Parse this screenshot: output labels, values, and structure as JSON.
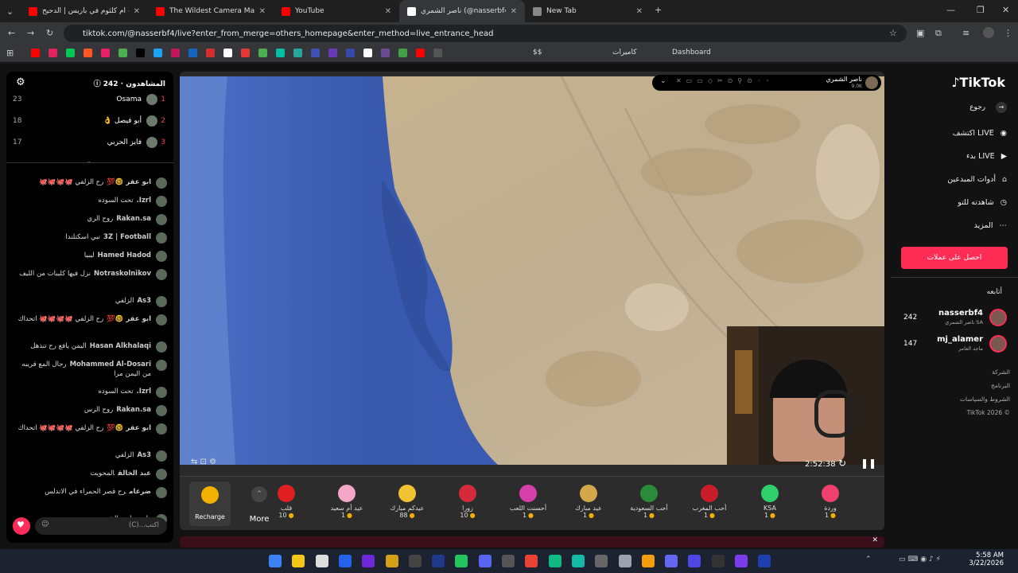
{
  "tabs": [
    {
      "label": "أم كلثوم في باريس | الدحيح - be",
      "color": "#ff0000"
    },
    {
      "label": "The Wildest Camera Market I've",
      "color": "#ff0000"
    },
    {
      "label": "YouTube",
      "color": "#ff0000"
    },
    {
      "label": "ناصر الشمري (@nasserbf4)",
      "color": "#ffffff"
    },
    {
      "label": "New Tab",
      "color": "#888888"
    }
  ],
  "address": {
    "url": "tiktok.com/@nasserbf4/live?enter_from_merge=others_homepage&enter_method=live_entrance_head"
  },
  "bookmarks": {
    "cameras_label": "كاميرات",
    "dashboard_label": "Dashboard",
    "dollars": "$$"
  },
  "chat": {
    "viewers_label": "المشاهدون",
    "viewers_count": "242",
    "top": [
      {
        "rank": "1",
        "name": "Osama",
        "score": "23",
        "rank_color": "#ff3b5c"
      },
      {
        "rank": "2",
        "name": "👌 أبو فيصل",
        "score": "18",
        "rank_color": "#ff3b5c"
      },
      {
        "rank": "3",
        "name": "فايز الحربي",
        "score": "17",
        "rank_color": "#ff3b5c"
      }
    ],
    "messages": [
      {
        "name": "ابو عقر 🤓💯",
        "text": "رح الزلفي 🐙🐙🐙🐙"
      },
      {
        "name": "Izrl.",
        "text": "تحت السوده"
      },
      {
        "name": "Rakan.sa",
        "text": "روح الري"
      },
      {
        "name": "3Z | Football",
        "text": "نبي اسكتلندا"
      },
      {
        "name": "Hamed Hadod",
        "text": "ليبيا"
      },
      {
        "name": "Notraskolnikov",
        "text": "نزل فيها كليبات من الليف"
      },
      {
        "name": "As3",
        "text": "الزلفي"
      },
      {
        "name": "ابو عقر 🤓💯",
        "text": "رح الزلفي 🐙🐙🐙🐙 اتحداك"
      },
      {
        "name": "Hasan Alkhalaqi",
        "text": "اليمن يافع رح تنذهل"
      },
      {
        "name": "Mohammed Al-Dosari",
        "text": "رجال المع قريبه من اليمن مرا"
      },
      {
        "name": "Izrl.",
        "text": "تحت السوده"
      },
      {
        "name": "Rakan.sa",
        "text": "روح الرس"
      },
      {
        "name": "ابو عقر 🤓💯",
        "text": "رح الزلفي 🐙🐙🐙🐙 اتحداك"
      },
      {
        "name": "As3",
        "text": "الزلفي"
      },
      {
        "name": "عبد الخالق",
        "text": "المحويت"
      },
      {
        "name": "ضرغام",
        "text": "رح قصر الحمراء في الاندلس"
      },
      {
        "name": "",
        "text": "انضم امير الشمر"
      }
    ],
    "input_placeholder": "اكتب...(C)"
  },
  "stream": {
    "host_name": "ناصر الشمري",
    "host_likes": "9.0K",
    "timer": "2:52:38",
    "gifts": [
      {
        "name": "قلب",
        "price": "10",
        "color": "#e02020"
      },
      {
        "name": "عيد أم سعيد",
        "price": "1",
        "color": "#f5a6c8"
      },
      {
        "name": "عيدكم مبارك",
        "price": "88",
        "color": "#f2c230"
      },
      {
        "name": "زورا",
        "price": "10",
        "color": "#d42a3a"
      },
      {
        "name": "أحسنت اللعب",
        "price": "1",
        "color": "#d63fa8"
      },
      {
        "name": "عيد مبارك",
        "price": "1",
        "color": "#d4a84a"
      },
      {
        "name": "أحب السعودية",
        "price": "1",
        "color": "#2a8c3a"
      },
      {
        "name": "أحب المغرب",
        "price": "1",
        "color": "#c81e2a"
      },
      {
        "name": "KSA",
        "price": "1",
        "color": "#2fd06a"
      },
      {
        "name": "وردة",
        "price": "1",
        "color": "#f04070"
      }
    ],
    "recharge_label": "Recharge",
    "more_label": "More"
  },
  "sidebar": {
    "logo": "TikTok",
    "back": "رجوع",
    "items": [
      "اكتشف LIVE",
      "بدء LIVE",
      "أدوات المبدعين",
      "شاهدته للتو",
      "المزيد"
    ],
    "coins_button": "احصل على عملات",
    "following_label": "أتابعه",
    "following": [
      {
        "name": "nasserbf4",
        "sub": "ناصر الشمري SA",
        "count": "242"
      },
      {
        "name": "mj_alamer",
        "sub": "ماجد العامر",
        "count": "147"
      }
    ],
    "links": [
      "الشركة",
      "البرنامج",
      "الشروط والسياسات",
      "TikTok 2026 ©"
    ]
  },
  "taskbar": {
    "time": "5:58 AM",
    "date": "3/22/2026"
  }
}
